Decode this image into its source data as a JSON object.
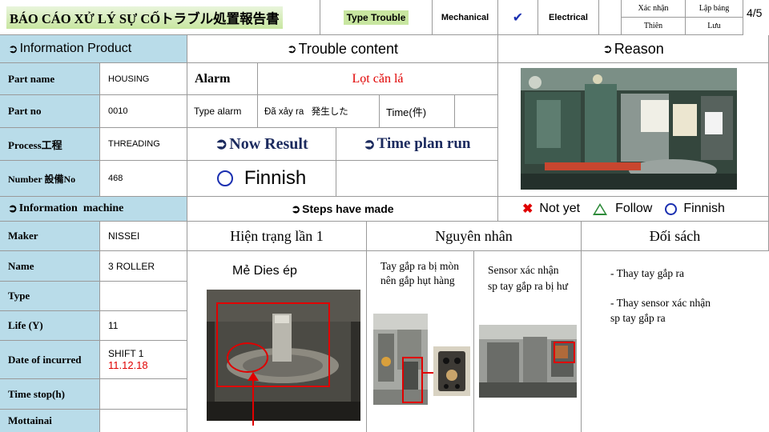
{
  "header": {
    "title": "BÁO CÁO XỬ LÝ SỰ CỐトラブル処置報告書",
    "type_trouble": "Type Trouble",
    "mechanical": "Mechanical",
    "check": "✔",
    "electrical": "Electrical",
    "confirm_label": "Xác nhận",
    "created_label": "Lập bảng",
    "confirm_name": "Thiên",
    "created_name": "Lưu",
    "page": "4/5"
  },
  "sections": {
    "info_product": "Information Product",
    "trouble_content": "Trouble content",
    "reason": "Reason",
    "info_machine": "Information  machine",
    "steps": "Steps have made",
    "now_result": "Now Result",
    "time_plan": "Time plan run"
  },
  "product": {
    "part_name_label": "Part name",
    "part_name": "HOUSING",
    "part_no_label": "Part no",
    "part_no": "0010",
    "process_label": "Process工程",
    "process": "THREADING",
    "number_label": "Number 設備No",
    "number": "468"
  },
  "trouble": {
    "alarm_label": "Alarm",
    "alarm_value": "Lọt cǎn lá",
    "type_alarm_label": "Type alarm",
    "occurred_label": "Đã xảy ra   発生した",
    "time_label": "Time(件)",
    "result_value": "Finnish"
  },
  "legend": {
    "not_yet": "Not yet",
    "follow": "Follow",
    "finnish": "Finnish"
  },
  "machine": {
    "maker_label": "Maker",
    "maker": "NISSEI",
    "name_label": "Name",
    "name": "3 ROLLER",
    "type_label": "Type",
    "life_label": "Life (Y)",
    "life": "11",
    "date_label": "Date of incurred",
    "shift": "SHIFT 1",
    "date": "11.12.18",
    "time_stop_label": "Time stop(h)",
    "mottainai_label": "Mottainai"
  },
  "steps": {
    "current_header": "Hiện trạng lần 1",
    "cause_header": "Nguyên nhân",
    "measure_header": "Đối sách",
    "current_text": "Mẻ Dies ép",
    "cause_1": "Tay gắp ra bị mòn nên gắp hụt hàng",
    "cause_2": "Sensor xác nhận sp tay gắp ra bị hư",
    "measure_1": "- Thay tay gắp ra",
    "measure_2": "- Thay sensor xác nhận sp tay gắp ra"
  },
  "colors": {
    "header_blue": "#b9dce9",
    "alert_red": "#e00000",
    "title_green": "#c8e6a0"
  }
}
